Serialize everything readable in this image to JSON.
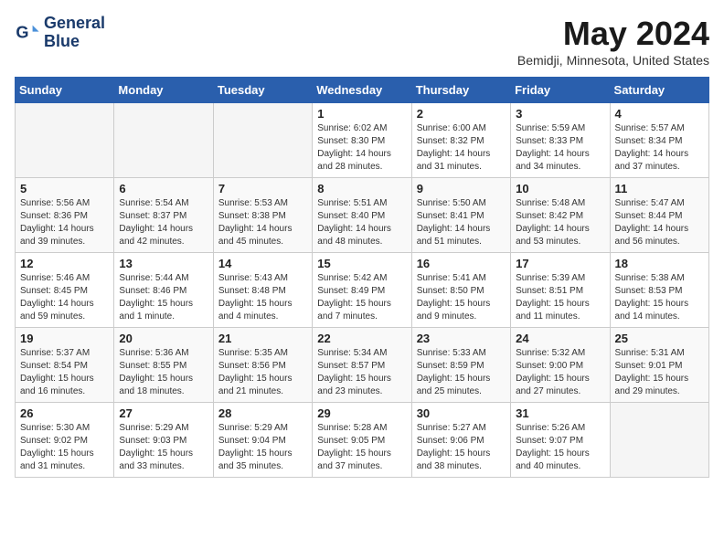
{
  "header": {
    "logo_line1": "General",
    "logo_line2": "Blue",
    "month_title": "May 2024",
    "location": "Bemidji, Minnesota, United States"
  },
  "days_of_week": [
    "Sunday",
    "Monday",
    "Tuesday",
    "Wednesday",
    "Thursday",
    "Friday",
    "Saturday"
  ],
  "weeks": [
    [
      {
        "day": "",
        "info": ""
      },
      {
        "day": "",
        "info": ""
      },
      {
        "day": "",
        "info": ""
      },
      {
        "day": "1",
        "info": "Sunrise: 6:02 AM\nSunset: 8:30 PM\nDaylight: 14 hours\nand 28 minutes."
      },
      {
        "day": "2",
        "info": "Sunrise: 6:00 AM\nSunset: 8:32 PM\nDaylight: 14 hours\nand 31 minutes."
      },
      {
        "day": "3",
        "info": "Sunrise: 5:59 AM\nSunset: 8:33 PM\nDaylight: 14 hours\nand 34 minutes."
      },
      {
        "day": "4",
        "info": "Sunrise: 5:57 AM\nSunset: 8:34 PM\nDaylight: 14 hours\nand 37 minutes."
      }
    ],
    [
      {
        "day": "5",
        "info": "Sunrise: 5:56 AM\nSunset: 8:36 PM\nDaylight: 14 hours\nand 39 minutes."
      },
      {
        "day": "6",
        "info": "Sunrise: 5:54 AM\nSunset: 8:37 PM\nDaylight: 14 hours\nand 42 minutes."
      },
      {
        "day": "7",
        "info": "Sunrise: 5:53 AM\nSunset: 8:38 PM\nDaylight: 14 hours\nand 45 minutes."
      },
      {
        "day": "8",
        "info": "Sunrise: 5:51 AM\nSunset: 8:40 PM\nDaylight: 14 hours\nand 48 minutes."
      },
      {
        "day": "9",
        "info": "Sunrise: 5:50 AM\nSunset: 8:41 PM\nDaylight: 14 hours\nand 51 minutes."
      },
      {
        "day": "10",
        "info": "Sunrise: 5:48 AM\nSunset: 8:42 PM\nDaylight: 14 hours\nand 53 minutes."
      },
      {
        "day": "11",
        "info": "Sunrise: 5:47 AM\nSunset: 8:44 PM\nDaylight: 14 hours\nand 56 minutes."
      }
    ],
    [
      {
        "day": "12",
        "info": "Sunrise: 5:46 AM\nSunset: 8:45 PM\nDaylight: 14 hours\nand 59 minutes."
      },
      {
        "day": "13",
        "info": "Sunrise: 5:44 AM\nSunset: 8:46 PM\nDaylight: 15 hours\nand 1 minute."
      },
      {
        "day": "14",
        "info": "Sunrise: 5:43 AM\nSunset: 8:48 PM\nDaylight: 15 hours\nand 4 minutes."
      },
      {
        "day": "15",
        "info": "Sunrise: 5:42 AM\nSunset: 8:49 PM\nDaylight: 15 hours\nand 7 minutes."
      },
      {
        "day": "16",
        "info": "Sunrise: 5:41 AM\nSunset: 8:50 PM\nDaylight: 15 hours\nand 9 minutes."
      },
      {
        "day": "17",
        "info": "Sunrise: 5:39 AM\nSunset: 8:51 PM\nDaylight: 15 hours\nand 11 minutes."
      },
      {
        "day": "18",
        "info": "Sunrise: 5:38 AM\nSunset: 8:53 PM\nDaylight: 15 hours\nand 14 minutes."
      }
    ],
    [
      {
        "day": "19",
        "info": "Sunrise: 5:37 AM\nSunset: 8:54 PM\nDaylight: 15 hours\nand 16 minutes."
      },
      {
        "day": "20",
        "info": "Sunrise: 5:36 AM\nSunset: 8:55 PM\nDaylight: 15 hours\nand 18 minutes."
      },
      {
        "day": "21",
        "info": "Sunrise: 5:35 AM\nSunset: 8:56 PM\nDaylight: 15 hours\nand 21 minutes."
      },
      {
        "day": "22",
        "info": "Sunrise: 5:34 AM\nSunset: 8:57 PM\nDaylight: 15 hours\nand 23 minutes."
      },
      {
        "day": "23",
        "info": "Sunrise: 5:33 AM\nSunset: 8:59 PM\nDaylight: 15 hours\nand 25 minutes."
      },
      {
        "day": "24",
        "info": "Sunrise: 5:32 AM\nSunset: 9:00 PM\nDaylight: 15 hours\nand 27 minutes."
      },
      {
        "day": "25",
        "info": "Sunrise: 5:31 AM\nSunset: 9:01 PM\nDaylight: 15 hours\nand 29 minutes."
      }
    ],
    [
      {
        "day": "26",
        "info": "Sunrise: 5:30 AM\nSunset: 9:02 PM\nDaylight: 15 hours\nand 31 minutes."
      },
      {
        "day": "27",
        "info": "Sunrise: 5:29 AM\nSunset: 9:03 PM\nDaylight: 15 hours\nand 33 minutes."
      },
      {
        "day": "28",
        "info": "Sunrise: 5:29 AM\nSunset: 9:04 PM\nDaylight: 15 hours\nand 35 minutes."
      },
      {
        "day": "29",
        "info": "Sunrise: 5:28 AM\nSunset: 9:05 PM\nDaylight: 15 hours\nand 37 minutes."
      },
      {
        "day": "30",
        "info": "Sunrise: 5:27 AM\nSunset: 9:06 PM\nDaylight: 15 hours\nand 38 minutes."
      },
      {
        "day": "31",
        "info": "Sunrise: 5:26 AM\nSunset: 9:07 PM\nDaylight: 15 hours\nand 40 minutes."
      },
      {
        "day": "",
        "info": ""
      }
    ]
  ]
}
